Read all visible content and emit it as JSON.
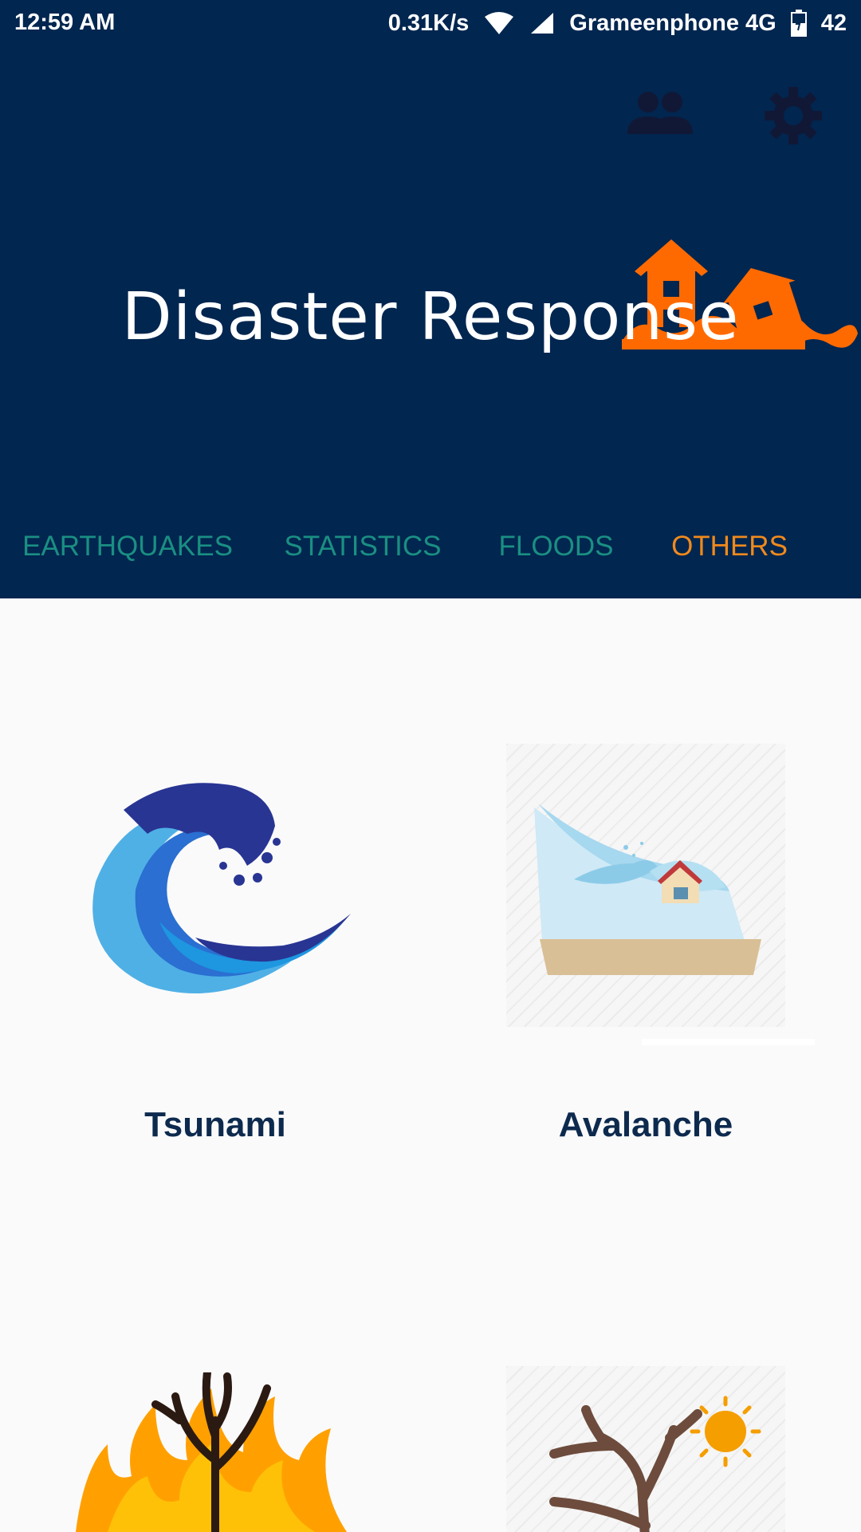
{
  "status_bar": {
    "time": "12:59 AM",
    "speed": "0.31K/s",
    "carrier": "Grameenphone 4G",
    "battery": "42",
    "icons": [
      "wifi-icon",
      "signal-icon",
      "battery-icon"
    ]
  },
  "header": {
    "title": "Disaster Response",
    "icons": [
      "people-icon",
      "gear-icon",
      "flood-house-icon"
    ],
    "background_color": "#012650",
    "accent_color": "#ff6a00"
  },
  "tabs": [
    {
      "label": "EARTHQUAKES",
      "selected": false
    },
    {
      "label": "STATISTICS",
      "selected": false
    },
    {
      "label": "FLOODS",
      "selected": false
    },
    {
      "label": "OTHERS",
      "selected": true
    }
  ],
  "colors": {
    "tab_inactive": "#1a8f82",
    "tab_active": "#f08a1c",
    "label": "#0d2a4e"
  },
  "cards": [
    {
      "label": "Tsunami",
      "icon": "tsunami-wave-icon"
    },
    {
      "label": "Avalanche",
      "icon": "avalanche-icon"
    },
    {
      "label": "",
      "icon": "wildfire-icon"
    },
    {
      "label": "",
      "icon": "drought-icon"
    }
  ]
}
